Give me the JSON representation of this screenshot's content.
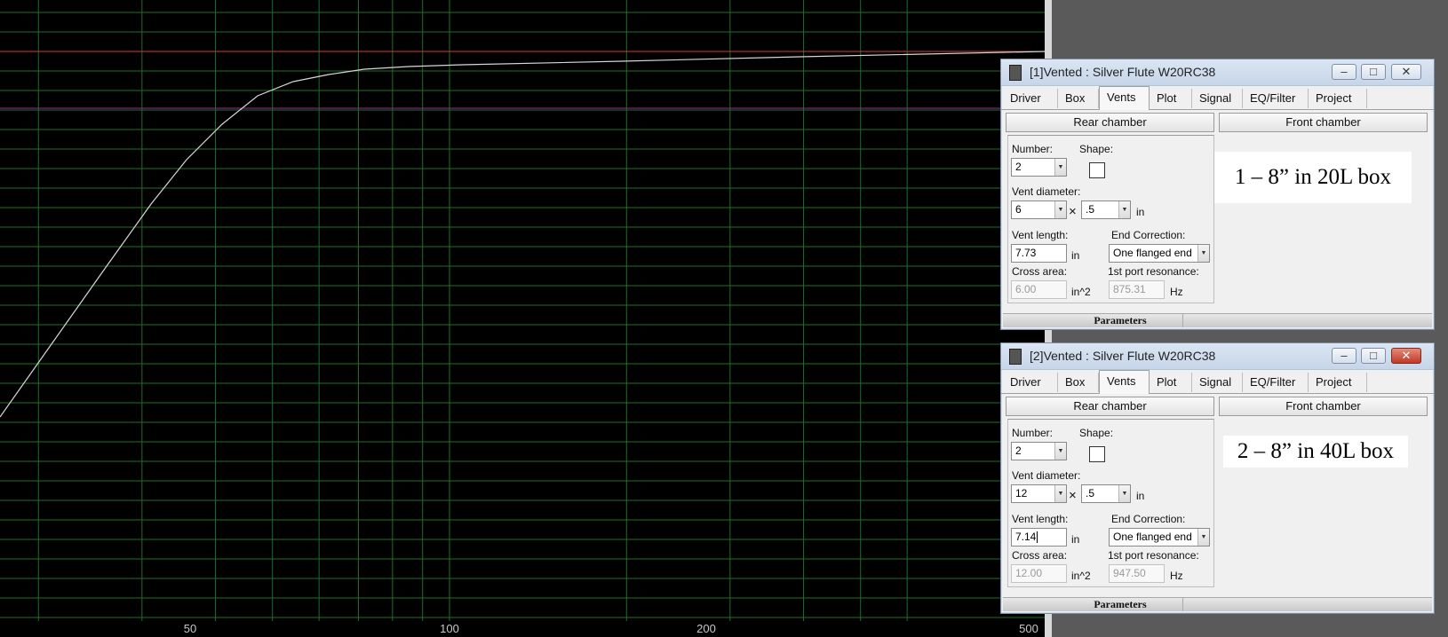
{
  "plot": {
    "background": "#000000",
    "grid_color": "#1f6f2a",
    "curve_color": "#d8d8d8",
    "ref_line_top_color": "#d23a3a",
    "ref_line_mid_color": "#9c2a9c",
    "x_tick_labels": [
      "50",
      "100",
      "200",
      "500"
    ],
    "x_scale": "log"
  },
  "windows": [
    {
      "title": "[1]Vented : Silver Flute  W20RC38",
      "close_active": false,
      "tabs": [
        "Driver",
        "Box",
        "Vents",
        "Plot",
        "Signal",
        "EQ/Filter",
        "Project"
      ],
      "active_tab": "Vents",
      "rear_chamber_label": "Rear chamber",
      "front_chamber_label": "Front chamber",
      "number_label": "Number:",
      "number_value": "2",
      "shape_label": "Shape:",
      "vent_diameter_label": "Vent diameter:",
      "vent_diameter_value": "6",
      "times_symbol": "×",
      "vent_diameter_fraction": ".5",
      "unit_in": "in",
      "vent_length_label": "Vent length:",
      "vent_length_value": "7.73",
      "end_correction_label": "End Correction:",
      "end_correction_value": "One flanged end",
      "cross_area_label": "Cross area:",
      "cross_area_value": "6.00",
      "cross_area_unit": "in^2",
      "port_resonance_label": "1st port resonance:",
      "port_resonance_value": "875.31",
      "port_resonance_unit": "Hz",
      "caption": "1 – 8” in 20L box",
      "parameters_label": "Parameters"
    },
    {
      "title": "[2]Vented : Silver Flute  W20RC38",
      "close_active": true,
      "tabs": [
        "Driver",
        "Box",
        "Vents",
        "Plot",
        "Signal",
        "EQ/Filter",
        "Project"
      ],
      "active_tab": "Vents",
      "rear_chamber_label": "Rear chamber",
      "front_chamber_label": "Front chamber",
      "number_label": "Number:",
      "number_value": "2",
      "shape_label": "Shape:",
      "vent_diameter_label": "Vent diameter:",
      "vent_diameter_value": "12",
      "times_symbol": "×",
      "vent_diameter_fraction": ".5",
      "unit_in": "in",
      "vent_length_label": "Vent length:",
      "vent_length_value": "7.14",
      "end_correction_label": "End Correction:",
      "end_correction_value": "One flanged end",
      "cross_area_label": "Cross area:",
      "cross_area_value": "12.00",
      "cross_area_unit": "in^2",
      "port_resonance_label": "1st port resonance:",
      "port_resonance_value": "947.50",
      "port_resonance_unit": "Hz",
      "caption": "2 – 8” in 40L box",
      "parameters_label": "Parameters"
    }
  ]
}
